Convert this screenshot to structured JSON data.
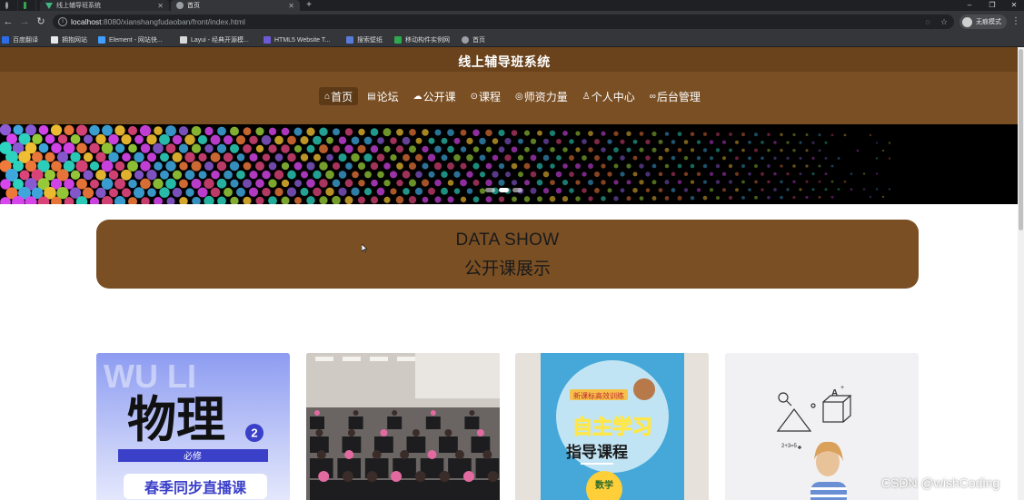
{
  "browser": {
    "tabs": [
      {
        "title": "线上辅导班系统"
      },
      {
        "title": "首页"
      }
    ],
    "url": {
      "host": "localhost",
      "rest": ":8080/xianshangfudaoban/front/index.html"
    },
    "incognito_label": "无痕模式",
    "bookmarks": [
      {
        "label": "百度翻译",
        "color": "#2b6de8"
      },
      {
        "label": "拥抱网站",
        "color": "#e8e8e8"
      },
      {
        "label": "Element - 网站快...",
        "color": "#409eff"
      },
      {
        "label": "Layui - 经典开源模...",
        "color": "#d8d8d8"
      },
      {
        "label": "HTML5 Website T...",
        "color": "#6b5bd6"
      },
      {
        "label": "搜索壁纸",
        "color": "#5a7bd8"
      },
      {
        "label": "移动构件实例网",
        "color": "#2fa84f"
      },
      {
        "label": "首页",
        "color": "#9aa0a6"
      }
    ]
  },
  "site": {
    "title": "线上辅导班系统",
    "nav": [
      {
        "label": "首页",
        "icon": "home-icon",
        "glyph": "⌂",
        "active": true
      },
      {
        "label": "论坛",
        "icon": "forum-icon",
        "glyph": "▤",
        "active": false
      },
      {
        "label": "公开课",
        "icon": "cloud-icon",
        "glyph": "☁",
        "active": false
      },
      {
        "label": "课程",
        "icon": "course-icon",
        "glyph": "⊙",
        "active": false
      },
      {
        "label": "师资力量",
        "icon": "teacher-icon",
        "glyph": "◎",
        "active": false
      },
      {
        "label": "个人中心",
        "icon": "user-icon",
        "glyph": "♙",
        "active": false
      },
      {
        "label": "后台管理",
        "icon": "link-icon",
        "glyph": "∞",
        "active": false
      }
    ],
    "carousel": {
      "slide_count": 3,
      "active_index": 1
    },
    "section": {
      "title_en": "DATA SHOW",
      "title_zh": "公开课展示"
    },
    "cards": [
      {
        "subject_bg_text": "WU LI",
        "subject": "物理",
        "badge": "2",
        "tag": "必修",
        "caption": "春季同步直播课"
      },
      {
        "caption": ""
      },
      {
        "top_text": "新课标高效训练",
        "main": "自主学习",
        "sub": "指导课程",
        "grade": "数学"
      },
      {
        "formula": "2+3=5"
      }
    ]
  },
  "watermark": "CSDN @wishCoding",
  "colors": {
    "header_brown": "#7a4f24",
    "section_brown": "#7a4f24",
    "chrome_dark": "#35363a"
  }
}
